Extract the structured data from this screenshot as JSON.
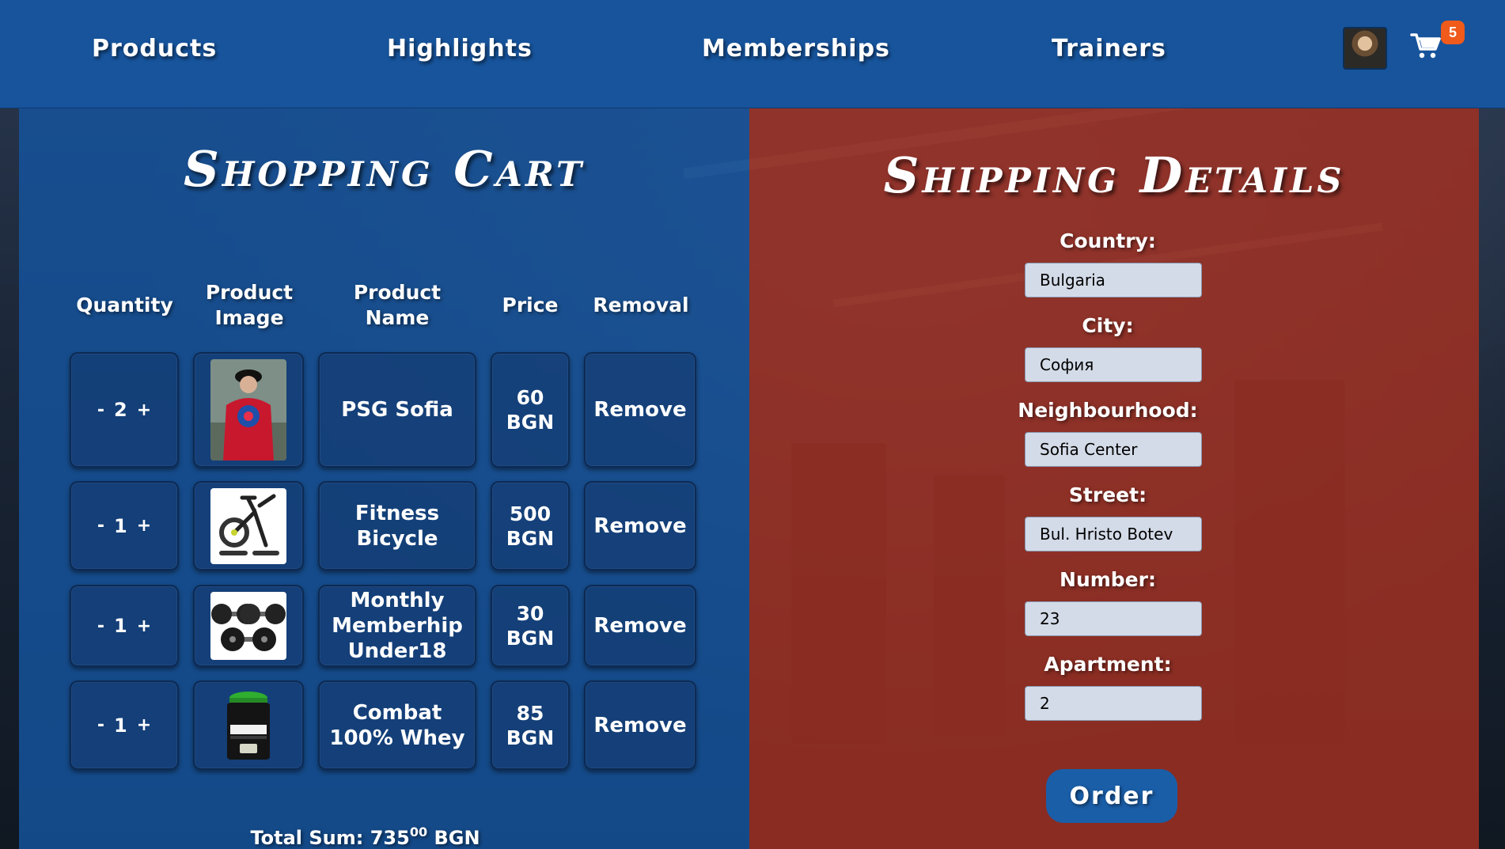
{
  "nav": {
    "links": [
      "Products",
      "Highlights",
      "Memberships",
      "Trainers"
    ],
    "cart_count": "5"
  },
  "cart": {
    "title": "Shopping Cart",
    "headers": {
      "quantity": "Quantity",
      "image": "Product Image",
      "name": "Product Name",
      "price": "Price",
      "removal": "Removal"
    },
    "rows": [
      {
        "qty": "2",
        "name": "PSG Sofia",
        "price": "60 BGN",
        "remove": "Remove",
        "image_icon": "red-hoodie-image"
      },
      {
        "qty": "1",
        "name": "Fitness Bicycle",
        "price": "500 BGN",
        "remove": "Remove",
        "image_icon": "exercise-bike-image"
      },
      {
        "qty": "1",
        "name": "Monthly Memberhip Under18",
        "price": "30 BGN",
        "remove": "Remove",
        "image_icon": "dumbbells-image"
      },
      {
        "qty": "1",
        "name": "Combat 100% Whey",
        "price": "85 BGN",
        "remove": "Remove",
        "image_icon": "protein-tub-image"
      }
    ],
    "minus": "-",
    "plus": "+",
    "total_label": "Total Sum: 735",
    "total_cents": "00",
    "total_currency": "BGN"
  },
  "shipping": {
    "title": "Shipping Details",
    "fields": [
      {
        "label": "Country:",
        "value": "Bulgaria"
      },
      {
        "label": "City:",
        "value": "София"
      },
      {
        "label": "Neighbourhood:",
        "value": "Sofia Center"
      },
      {
        "label": "Street:",
        "value": "Bul. Hristo Botev"
      },
      {
        "label": "Number:",
        "value": "23"
      },
      {
        "label": "Apartment:",
        "value": "2"
      }
    ],
    "order_label": "Order"
  },
  "colors": {
    "header": "#17549c",
    "left_panel": "#16549c",
    "right_panel": "#9e3022",
    "badge": "#f05a1a"
  }
}
